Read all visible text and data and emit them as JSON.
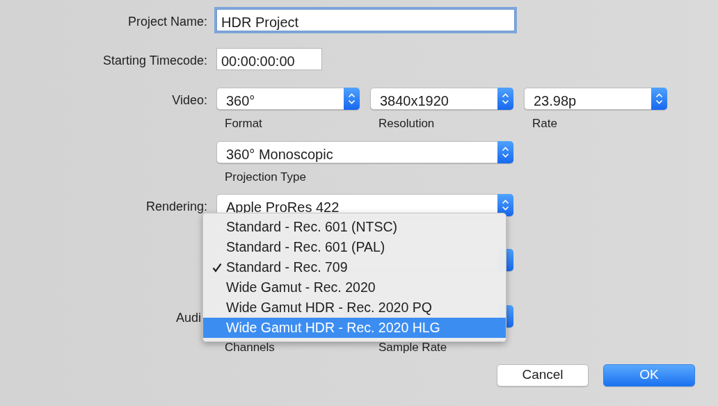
{
  "project_name": {
    "label": "Project Name:",
    "value": "HDR Project",
    "focused": true
  },
  "starting_timecode": {
    "label": "Starting Timecode:",
    "value": "00:00:00:00",
    "focused": false
  },
  "video": {
    "label": "Video:",
    "popups": [
      {
        "value": "360°",
        "caption": "Format"
      },
      {
        "value": "3840x1920",
        "caption": "Resolution"
      },
      {
        "value": "23.98p",
        "caption": "Rate"
      }
    ]
  },
  "projection": {
    "value": "360° Monoscopic",
    "caption": "Projection Type"
  },
  "rendering": {
    "label": "Rendering:",
    "value": "Apple ProRes 422"
  },
  "audio": {
    "label": "Audi",
    "captions": [
      "Channels",
      "Sample Rate"
    ]
  },
  "menu": {
    "items": [
      {
        "label": "Standard - Rec. 601 (NTSC)",
        "checked": false,
        "selected": false
      },
      {
        "label": "Standard - Rec. 601 (PAL)",
        "checked": false,
        "selected": false
      },
      {
        "label": "Standard - Rec. 709",
        "checked": true,
        "selected": false
      },
      {
        "label": "Wide Gamut - Rec. 2020",
        "checked": false,
        "selected": false
      },
      {
        "label": "Wide Gamut HDR - Rec. 2020 PQ",
        "checked": false,
        "selected": false
      },
      {
        "label": "Wide Gamut HDR - Rec. 2020 HLG",
        "checked": false,
        "selected": true
      }
    ]
  },
  "buttons": [
    {
      "label": "Cancel",
      "kind": "secondary"
    },
    {
      "label": "OK",
      "kind": "default"
    }
  ]
}
